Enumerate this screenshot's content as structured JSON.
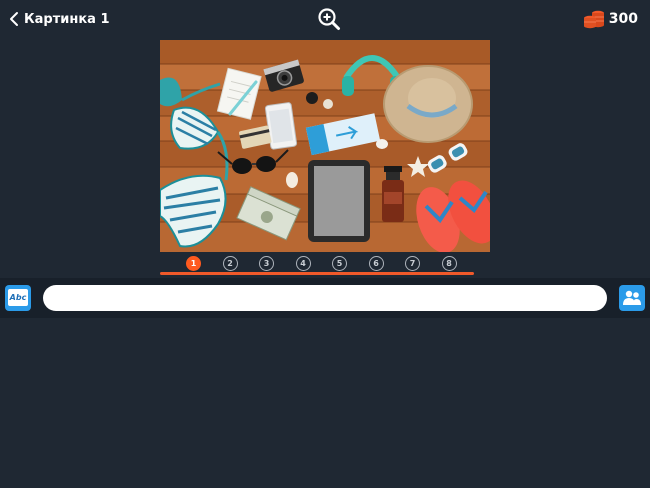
{
  "header": {
    "back_icon": "chevron-left-icon",
    "title": "Картинка 1",
    "zoom_icon": "zoom-in-icon",
    "coins_icon": "coin-stack-icon",
    "coins": "300",
    "coin_color": "#f0592a"
  },
  "picture": {
    "icon": "beach-travel-flatlay-photo"
  },
  "pager": {
    "items": [
      "1",
      "2",
      "3",
      "4",
      "5",
      "6",
      "7",
      "8"
    ],
    "active_index": 0,
    "active_color": "#ff5a1f"
  },
  "answer": {
    "hint_icon": "abc-letters-icon",
    "hint_label": "Abc",
    "value": "",
    "placeholder": "",
    "friends_icon": "friends-icon",
    "accent": "#2b9be9"
  }
}
